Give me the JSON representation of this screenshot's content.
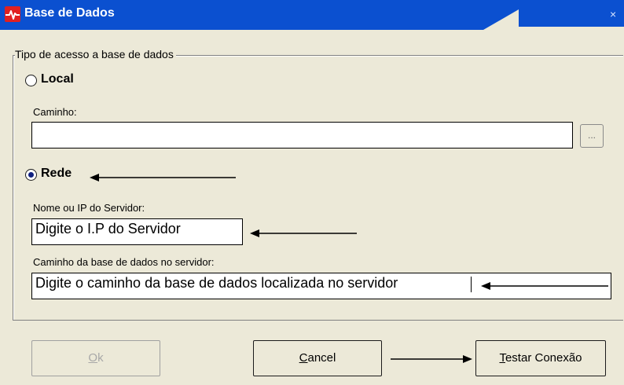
{
  "window": {
    "title": "Base de Dados",
    "close_glyph": "×",
    "app_icon": "heartbeat-icon",
    "colors": {
      "titlebar": "#0b50d0",
      "background": "#ece9d8",
      "icon": "#e02020",
      "selected_radio": "#102080"
    }
  },
  "group": {
    "legend": "Tipo de acesso a base de dados"
  },
  "local": {
    "label": "Local",
    "selected": false,
    "path_label": "Caminho:",
    "path_value": "",
    "browse_label": "..."
  },
  "rede": {
    "label": "Rede",
    "selected": true,
    "server_label": "Nome ou IP do Servidor:",
    "server_value": "Digite o I.P do Servidor",
    "db_path_label": "Caminho da base de dados no servidor:",
    "db_path_value": "Digite o caminho da base de dados localizada no servidor"
  },
  "buttons": {
    "ok": "Ok",
    "cancel": "Cancel",
    "test": "Testar Conexão"
  }
}
